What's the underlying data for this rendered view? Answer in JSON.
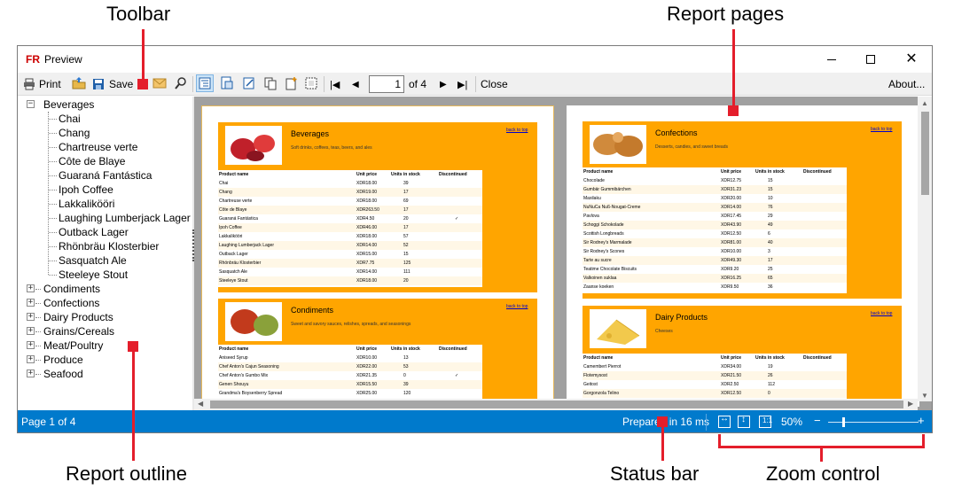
{
  "annotations": {
    "toolbar": "Toolbar",
    "report_pages": "Report pages",
    "report_outline": "Report outline",
    "status_bar": "Status bar",
    "zoom_control": "Zoom control"
  },
  "window": {
    "title": "Preview",
    "app_logo": "FR"
  },
  "toolbar": {
    "print_label": "Print",
    "save_label": "Save",
    "page_input": "1",
    "page_of": "of 4",
    "close_label": "Close",
    "about_label": "About..."
  },
  "outline": {
    "expanded": {
      "label": "Beverages",
      "children": [
        "Chai",
        "Chang",
        "Chartreuse verte",
        "Côte de Blaye",
        "Guaraná Fantástica",
        "Ipoh Coffee",
        "Lakkalikööri",
        "Laughing Lumberjack Lager",
        "Outback Lager",
        "Rhönbräu Klosterbier",
        "Sasquatch Ale",
        "Steeleye Stout"
      ]
    },
    "collapsed": [
      "Condiments",
      "Confections",
      "Dairy Products",
      "Grains/Cereals",
      "Meat/Poultry",
      "Produce",
      "Seafood"
    ]
  },
  "pages": {
    "back_to_top": "back to top",
    "columns": [
      "Product name",
      "Unit price",
      "Units in stock",
      "Discontinued"
    ],
    "beverages": {
      "title": "Beverages",
      "desc": "Soft drinks, coffees, teas, beers, and ales",
      "rows": [
        [
          "Chai",
          "XDR18.00",
          "39",
          ""
        ],
        [
          "Chang",
          "XDR19.00",
          "17",
          ""
        ],
        [
          "Chartreuse verte",
          "XDR18.00",
          "69",
          ""
        ],
        [
          "Côte de Blaye",
          "XDR263.50",
          "17",
          ""
        ],
        [
          "Guaraná Fantástica",
          "XDR4.50",
          "20",
          "✓"
        ],
        [
          "Ipoh Coffee",
          "XDR46.00",
          "17",
          ""
        ],
        [
          "Lakkalikööri",
          "XDR18.00",
          "57",
          ""
        ],
        [
          "Laughing Lumberjack Lager",
          "XDR14.00",
          "52",
          ""
        ],
        [
          "Outback Lager",
          "XDR15.00",
          "15",
          ""
        ],
        [
          "Rhönbräu Klosterbier",
          "XDR7.75",
          "125",
          ""
        ],
        [
          "Sasquatch Ale",
          "XDR14.00",
          "111",
          ""
        ],
        [
          "Steeleye Stout",
          "XDR18.00",
          "20",
          ""
        ]
      ]
    },
    "condiments": {
      "title": "Condiments",
      "desc": "Sweet and savory sauces, relishes, spreads, and seasonings",
      "rows": [
        [
          "Aniseed Syrup",
          "XDR10.00",
          "13",
          ""
        ],
        [
          "Chef Anton's Cajun Seasoning",
          "XDR22.00",
          "53",
          ""
        ],
        [
          "Chef Anton's Gumbo Mix",
          "XDR21.35",
          "0",
          "✓"
        ],
        [
          "Genen Shouyu",
          "XDR15.50",
          "39",
          ""
        ],
        [
          "Grandma's Boysenberry Spread",
          "XDR25.00",
          "120",
          ""
        ]
      ]
    },
    "confections": {
      "title": "Confections",
      "desc": "Desserts, candies, and sweet breads",
      "rows": [
        [
          "Chocolade",
          "XDR12.75",
          "15",
          ""
        ],
        [
          "Gumbär Gummibärchen",
          "XDR31.23",
          "15",
          ""
        ],
        [
          "Maxilaku",
          "XDR20.00",
          "10",
          ""
        ],
        [
          "NuNuCa Nuß-Nougat-Creme",
          "XDR14.00",
          "76",
          ""
        ],
        [
          "Pavlova",
          "XDR17.45",
          "29",
          ""
        ],
        [
          "Schoggi Schokolade",
          "XDR43.90",
          "49",
          ""
        ],
        [
          "Scottish Longbreads",
          "XDR12.50",
          "6",
          ""
        ],
        [
          "Sir Rodney's Marmalade",
          "XDR81.00",
          "40",
          ""
        ],
        [
          "Sir Rodney's Scones",
          "XDR10.00",
          "3",
          ""
        ],
        [
          "Tarte au sucre",
          "XDR49.30",
          "17",
          ""
        ],
        [
          "Teatime Chocolate Biscuits",
          "XDR9.20",
          "25",
          ""
        ],
        [
          "Valkoinen suklaa",
          "XDR16.25",
          "65",
          ""
        ],
        [
          "Zaanse koeken",
          "XDR9.50",
          "36",
          ""
        ]
      ]
    },
    "dairy": {
      "title": "Dairy Products",
      "desc": "Cheeses",
      "rows": [
        [
          "Camembert Pierrot",
          "XDR34.00",
          "19",
          ""
        ],
        [
          "Flotemysost",
          "XDR21.50",
          "26",
          ""
        ],
        [
          "Geitost",
          "XDR2.50",
          "112",
          ""
        ],
        [
          "Gorgonzola Telino",
          "XDR12.50",
          "0",
          ""
        ]
      ]
    }
  },
  "status": {
    "page": "Page 1 of 4",
    "prepared": "Prepared in 16 ms",
    "zoom": "50%"
  },
  "colors": {
    "accent": "#007acc",
    "section": "#ffa500",
    "callout": "#e41e2b"
  }
}
